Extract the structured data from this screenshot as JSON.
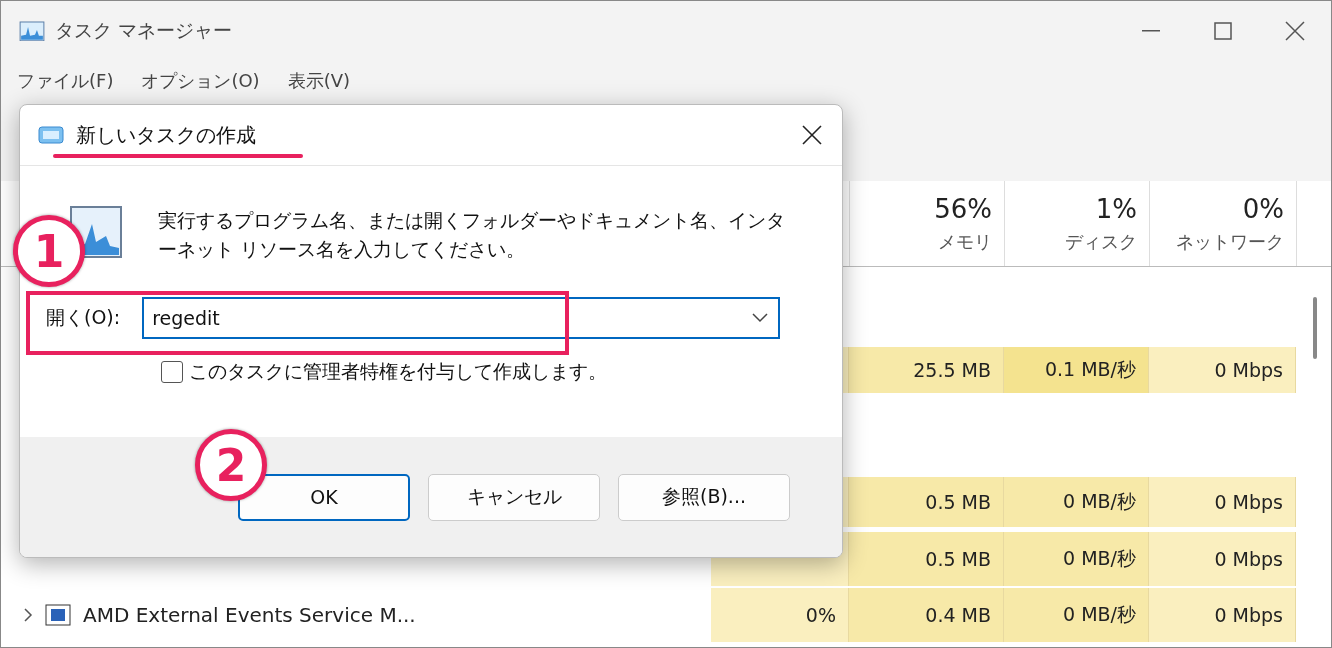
{
  "window": {
    "title": "タスク マネージャー"
  },
  "menu": [
    {
      "label": "ファイル(F)"
    },
    {
      "label": "オプション(O)"
    },
    {
      "label": "表示(V)"
    }
  ],
  "table": {
    "columns": [
      {
        "percent": "56%",
        "label": "メモリ"
      },
      {
        "percent": "1%",
        "label": "ディスク"
      },
      {
        "percent": "0%",
        "label": "ネットワーク"
      }
    ],
    "rows": [
      {
        "memory": "25.5 MB",
        "disk": "0.1 MB/秒",
        "network": "0 Mbps"
      },
      {
        "memory": "0.5 MB",
        "disk": "0 MB/秒",
        "network": "0 Mbps"
      },
      {
        "memory": "0.5 MB",
        "disk": "0 MB/秒",
        "network": "0 Mbps"
      },
      {
        "name": "AMD External Events Service M...",
        "cpu": "0%",
        "memory": "0.4 MB",
        "disk": "0 MB/秒",
        "network": "0 Mbps"
      }
    ]
  },
  "dialog": {
    "title": "新しいタスクの作成",
    "message": "実行するプログラム名、または開くフォルダーやドキュメント名、インターネット リソース名を入力してください。",
    "open_label": "開く(O):",
    "open_value": "regedit",
    "admin_checkbox": {
      "label": "このタスクに管理者特権を付与して作成します。",
      "checked": false
    },
    "buttons": [
      {
        "label": "OK",
        "default": true
      },
      {
        "label": "キャンセル",
        "default": false
      },
      {
        "label": "参照(B)...",
        "default": false
      }
    ]
  },
  "annotations": [
    {
      "number": "1"
    },
    {
      "number": "2"
    }
  ]
}
